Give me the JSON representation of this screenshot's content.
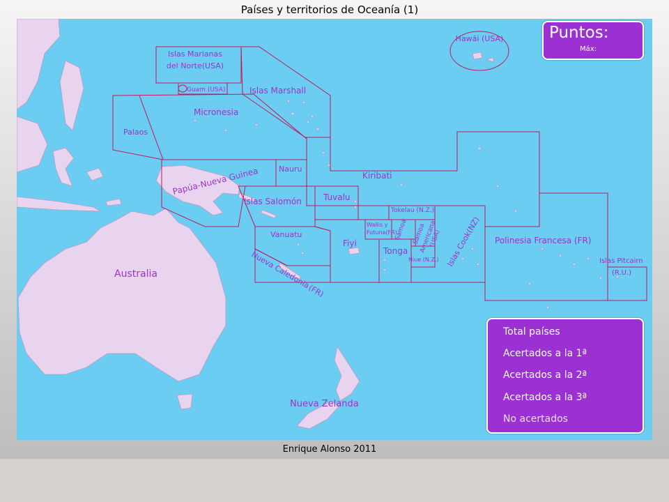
{
  "header": {
    "title": "Países y territorios de Oceanía (1)"
  },
  "footer": {
    "credit": "Enrique Alonso 2011"
  },
  "score": {
    "points_label": "Puntos:",
    "max_label": "Máx:"
  },
  "stats": {
    "total": "Total países",
    "first": "Acertados a la 1ª",
    "second": "Acertados a la 2ª",
    "third": "Acertados a la 3ª",
    "missed": "No acertados"
  },
  "map": {
    "labels": {
      "hawaii": "Hawái (USA)",
      "marianas1": "Islas Marianas",
      "marianas2": "del Norte(USA)",
      "guam": "Guam (USA)",
      "marshall": "Islas Marshall",
      "micronesia": "Micronesia",
      "palaos": "Palaos",
      "nauru": "Nauru",
      "kiribati": "Kiribati",
      "png": "Papúa-Nueva Guinea",
      "salomon": "Islas Salomón",
      "tuvalu": "Tuvalu",
      "tokelau": "Tokelau (N.Z.)",
      "wallis1": "Wallis y",
      "wallis2": "Futuna(FR)",
      "samoa": "Samoa",
      "amsamoa1": "Samoa",
      "amsamoa2": "Americana",
      "amsamoa3": "(USA)",
      "cook": "Islas Cook(NZ)",
      "polinesia": "Polinesia Francesa (FR)",
      "pitcairn1": "Islas Pitcairn",
      "pitcairn2": "(R.U.)",
      "vanuatu": "Vanuatu",
      "fiyi": "Fiyi",
      "tonga": "Tonga",
      "niue": "Niue (N.Z.)",
      "caledonia1": "Nueva Caledonia",
      "caledonia2": "(FR)",
      "australia": "Australia",
      "zelanda": "Nueva Zelanda"
    }
  },
  "colors": {
    "ocean": "#6ccdf2",
    "land": "#e8d4ee",
    "border": "#c0185a",
    "label": "#9b34c9",
    "panel": "#9b30d3"
  }
}
